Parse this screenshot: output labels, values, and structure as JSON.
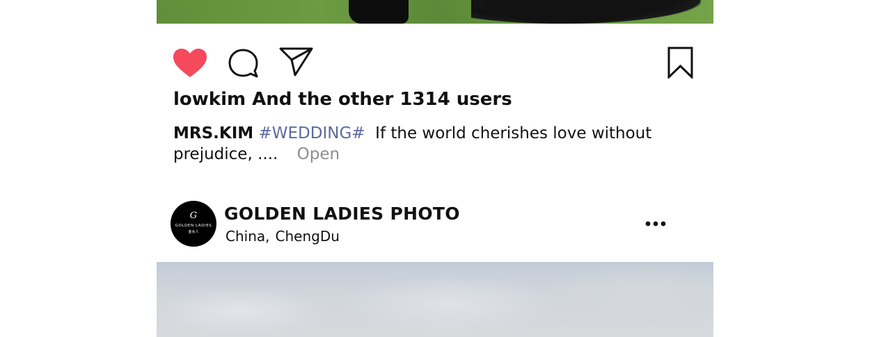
{
  "post": {
    "likes_text": "lowkim And the other 1314 users",
    "caption": {
      "author": "MRS.KIM",
      "hashtag": "#WEDDING#",
      "text": "If the world cherishes love without prejudice, ....",
      "more_label": "Open"
    },
    "actions": {
      "like_icon": "heart-icon",
      "like_color": "#f5495c",
      "comment_icon": "comment-bubble-icon",
      "share_icon": "paper-plane-icon",
      "save_icon": "bookmark-icon"
    }
  },
  "next_post": {
    "account_name": "GOLDEN LADIES PHOTO",
    "location_country": "China,",
    "location_city": "ChengDu",
    "avatar": {
      "monogram": "G",
      "brand": "GOLDEN LADIES",
      "subtitle": "金女人"
    },
    "menu_icon": "more-horizontal-icon"
  }
}
